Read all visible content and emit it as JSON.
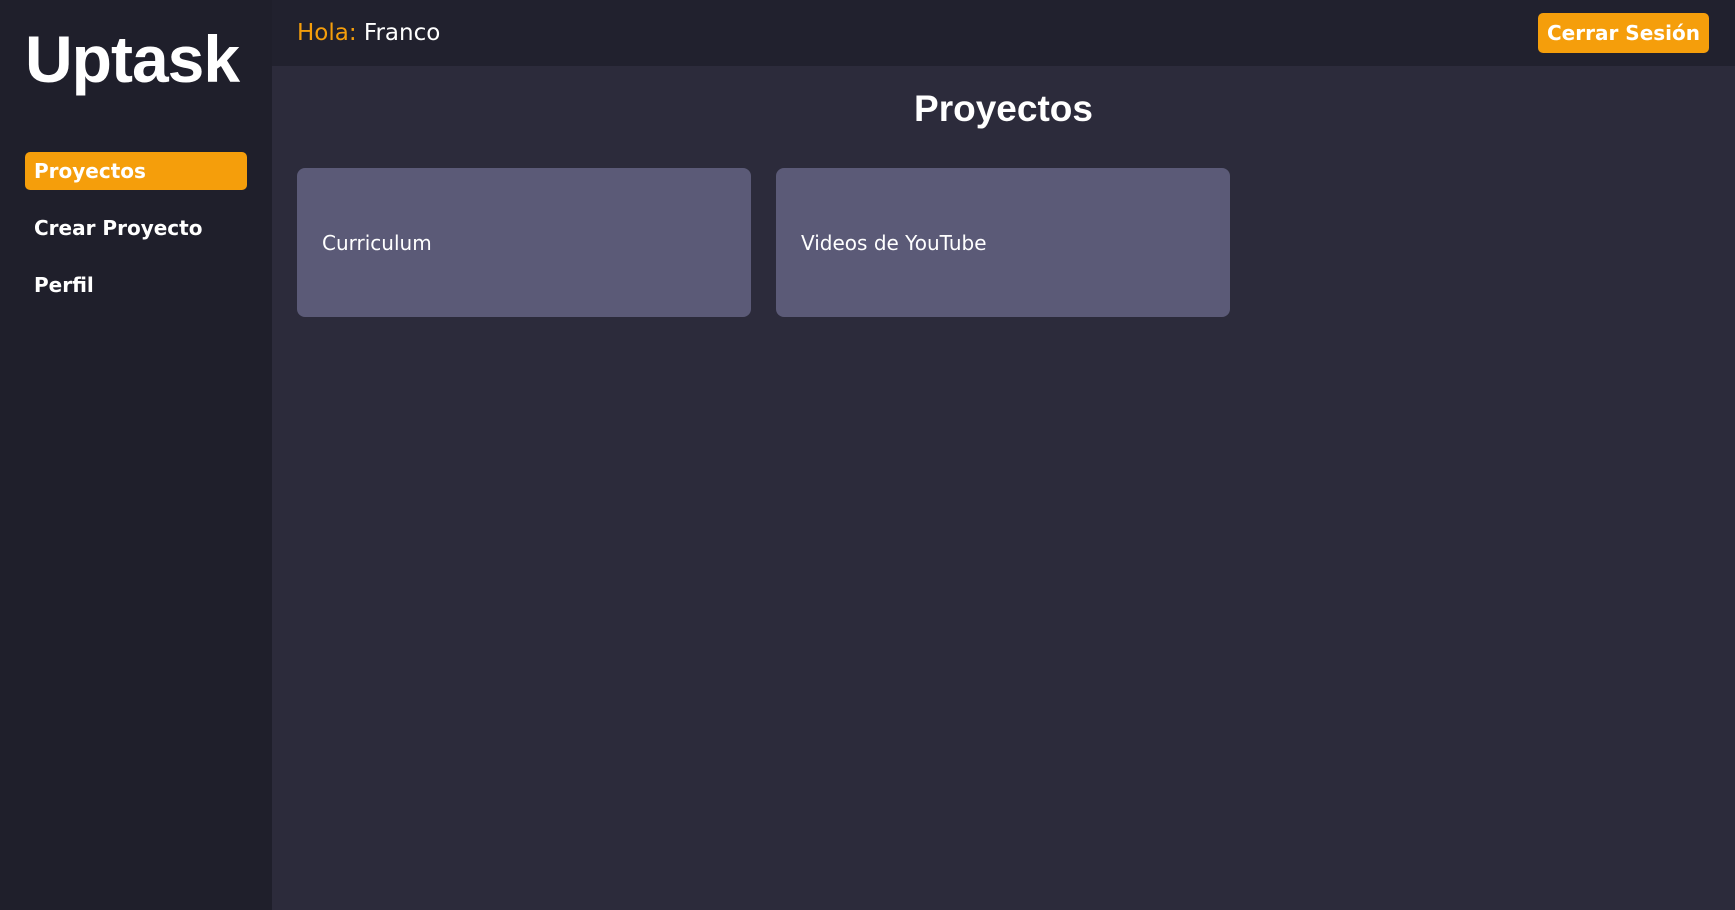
{
  "sidebar": {
    "logo": "Uptask",
    "items": [
      {
        "label": "Proyectos",
        "active": true
      },
      {
        "label": "Crear Proyecto",
        "active": false
      },
      {
        "label": "Perfil",
        "active": false
      }
    ]
  },
  "header": {
    "greeting_label": "Hola:",
    "user_name": "Franco",
    "logout_label": "Cerrar Sesión"
  },
  "main": {
    "title": "Proyectos",
    "projects": [
      {
        "name": "Curriculum"
      },
      {
        "name": "Videos de YouTube"
      }
    ]
  },
  "colors": {
    "accent": "#f59e0b",
    "sidebar_bg": "#1f1f2b",
    "content_bg": "#2c2b3b",
    "card_bg": "#5b5a77"
  }
}
